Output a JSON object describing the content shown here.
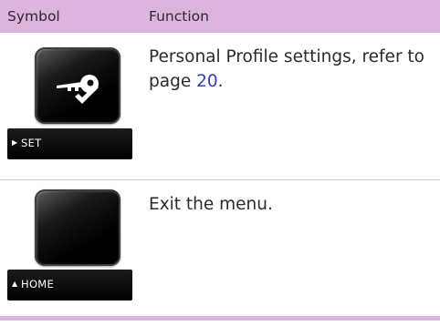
{
  "header": {
    "symbol": "Symbol",
    "function": "Function"
  },
  "rows": [
    {
      "button_icon": "key-check-icon",
      "softkey_glyph": "▶",
      "softkey_label": "SET",
      "description_before": "Personal Profile settings, refer to page ",
      "page_link": "20",
      "description_after": "."
    },
    {
      "button_icon": "blank-button",
      "softkey_glyph": "▲",
      "softkey_label": "HOME",
      "description": "Exit the menu."
    }
  ],
  "colors": {
    "header_background": "#dcb4de",
    "link": "#2f3fbf",
    "button": "#000000"
  }
}
